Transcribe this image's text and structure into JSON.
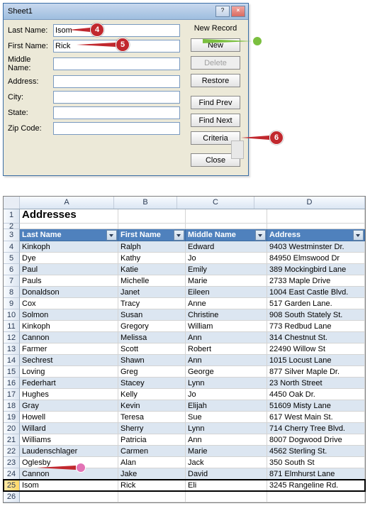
{
  "dialog": {
    "title": "Sheet1",
    "status": "New Record",
    "fields": {
      "last_name_label": "Last Name:",
      "first_name_label": "First Name:",
      "middle_name_label": "Middle Name:",
      "address_label": "Address:",
      "city_label": "City:",
      "state_label": "State:",
      "zip_label": "Zip Code:",
      "last_name_value": "Isom",
      "first_name_value": "Rick",
      "middle_name_value": "",
      "address_value": "",
      "city_value": "",
      "state_value": "",
      "zip_value": ""
    },
    "buttons": {
      "new": "New",
      "delete": "Delete",
      "restore": "Restore",
      "find_prev": "Find Prev",
      "find_next": "Find Next",
      "criteria": "Criteria",
      "close": "Close"
    }
  },
  "callouts": {
    "c4": "4",
    "c5": "5",
    "c6": "6"
  },
  "sheet": {
    "title": "Addresses",
    "col_letters": [
      "A",
      "B",
      "C",
      "D"
    ],
    "headers": {
      "a": "Last Name",
      "b": "First Name",
      "c": "Middle Name",
      "d": "Address"
    },
    "rows": [
      {
        "n": "4",
        "a": "Kinkoph",
        "b": "Ralph",
        "c": "Edward",
        "d": "9403 Westminster Dr."
      },
      {
        "n": "5",
        "a": "Dye",
        "b": "Kathy",
        "c": "Jo",
        "d": "84950 Elmswood Dr"
      },
      {
        "n": "6",
        "a": "Paul",
        "b": "Katie",
        "c": "Emily",
        "d": "389 Mockingbird Lane"
      },
      {
        "n": "7",
        "a": "Pauls",
        "b": "Michelle",
        "c": "Marie",
        "d": "2733 Maple Drive"
      },
      {
        "n": "8",
        "a": "Donaldson",
        "b": "Janet",
        "c": "Eileen",
        "d": "1004 East Castle Blvd."
      },
      {
        "n": "9",
        "a": "Cox",
        "b": "Tracy",
        "c": "Anne",
        "d": "517 Garden Lane."
      },
      {
        "n": "10",
        "a": "Solmon",
        "b": "Susan",
        "c": "Christine",
        "d": "908 South Stately St."
      },
      {
        "n": "11",
        "a": "Kinkoph",
        "b": "Gregory",
        "c": "William",
        "d": "773 Redbud Lane"
      },
      {
        "n": "12",
        "a": "Cannon",
        "b": "Melissa",
        "c": "Ann",
        "d": "314 Chestnut St."
      },
      {
        "n": "13",
        "a": "Farmer",
        "b": "Scott",
        "c": "Robert",
        "d": "22490 Willow St"
      },
      {
        "n": "14",
        "a": "Sechrest",
        "b": "Shawn",
        "c": "Ann",
        "d": "1015 Locust Lane"
      },
      {
        "n": "15",
        "a": "Loving",
        "b": "Greg",
        "c": "George",
        "d": "877 Silver Maple Dr."
      },
      {
        "n": "16",
        "a": "Federhart",
        "b": "Stacey",
        "c": "Lynn",
        "d": "23 North Street"
      },
      {
        "n": "17",
        "a": "Hughes",
        "b": "Kelly",
        "c": "Jo",
        "d": "4450 Oak Dr."
      },
      {
        "n": "18",
        "a": "Gray",
        "b": "Kevin",
        "c": "Elijah",
        "d": "51609 Misty Lane"
      },
      {
        "n": "19",
        "a": "Howell",
        "b": "Teresa",
        "c": "Sue",
        "d": "617 West Main St."
      },
      {
        "n": "20",
        "a": "Willard",
        "b": "Sherry",
        "c": "Lynn",
        "d": "714 Cherry Tree Blvd."
      },
      {
        "n": "21",
        "a": "Williams",
        "b": "Patricia",
        "c": "Ann",
        "d": "8007 Dogwood Drive"
      },
      {
        "n": "22",
        "a": "Laudenschlager",
        "b": "Carmen",
        "c": "Marie",
        "d": "4562 Sterling St."
      },
      {
        "n": "23",
        "a": "Oglesby",
        "b": "Alan",
        "c": "Jack",
        "d": "350 South St"
      },
      {
        "n": "24",
        "a": "Cannon",
        "b": "Jake",
        "c": "David",
        "d": "871 Elmhurst Lane"
      },
      {
        "n": "25",
        "a": "Isom",
        "b": "Rick",
        "c": "Eli",
        "d": "3245 Rangeline Rd."
      }
    ],
    "trailing_row": "26"
  }
}
